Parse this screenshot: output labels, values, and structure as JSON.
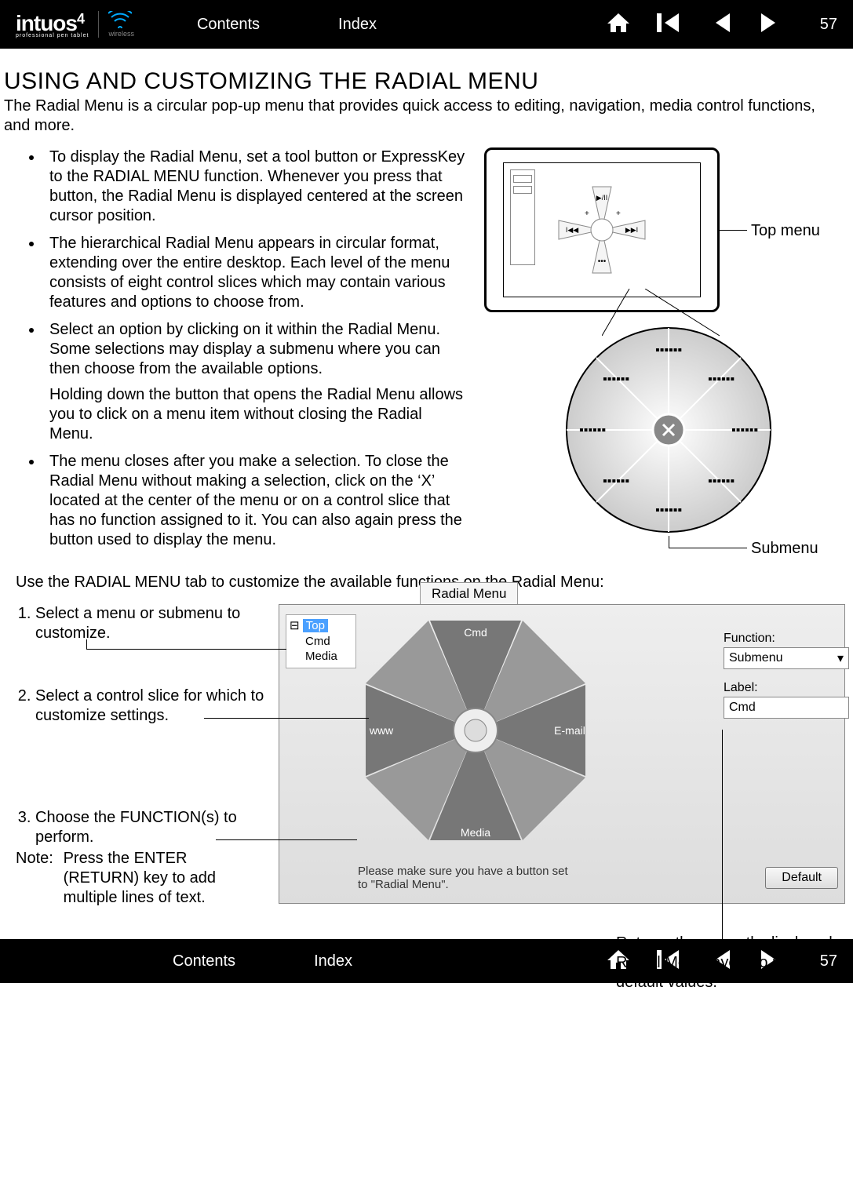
{
  "page_number": "57",
  "nav": {
    "contents": "Contents",
    "index": "Index"
  },
  "brand": {
    "name": "intuos",
    "suffix": "4",
    "tagline": "professional pen tablet",
    "wireless": "wireless"
  },
  "title": "USING AND CUSTOMIZING THE RADIAL MENU",
  "intro": "The Radial Menu is a circular pop-up menu that provides quick access to editing, navigation, media control functions, and more.",
  "bullets": [
    "To display the Radial Menu, set a tool button or ExpressKey to the RADIAL MENU function.  Whenever you press that button, the Radial Menu is displayed centered at the screen cursor position.",
    "The hierarchical Radial Menu appears in circular format, extending over the entire desktop.  Each level of the menu consists of eight control slices which may contain various features and options to choose from.",
    "Select an option by clicking on it within the Radial Menu.  Some selections may display a submenu where you can then choose from the available options.",
    "Holding down the button that opens the Radial Menu allows you to click on a menu item without closing the Radial Menu.",
    "The menu closes after you make a selection.  To close the Radial Menu without making a selection, click on the ‘X’ located at the center of the menu or on a control slice that has no function assigned to it.  You can also again press the button used to display the menu."
  ],
  "diagram": {
    "top_label": "Top menu",
    "sub_label": "Submenu"
  },
  "subhead": "Use the RADIAL MENU tab to customize the available functions on the Radial Menu:",
  "steps": [
    "Select a menu or submenu to customize.",
    "Select a control slice for which to customize settings.",
    "Choose the FUNCTION(s) to perform."
  ],
  "note_label": "Note:",
  "note_body": "Press the ENTER (RETURN) key to add multiple lines of text.",
  "screenshot": {
    "tab": "Radial Menu",
    "tree": {
      "root": "Top",
      "items": [
        "Cmd",
        "Media"
      ]
    },
    "slices": {
      "top": "Cmd",
      "left": "www",
      "right": "E-mail",
      "bottom": "Media"
    },
    "function_label": "Function:",
    "function_value": "Submenu",
    "label_label": "Label:",
    "label_value": "Cmd",
    "message": "Please make sure you have a button set to \"Radial Menu\".",
    "default_btn": "Default"
  },
  "callout_default": "Returns the currently displayed Radial Menu layout to its default values."
}
